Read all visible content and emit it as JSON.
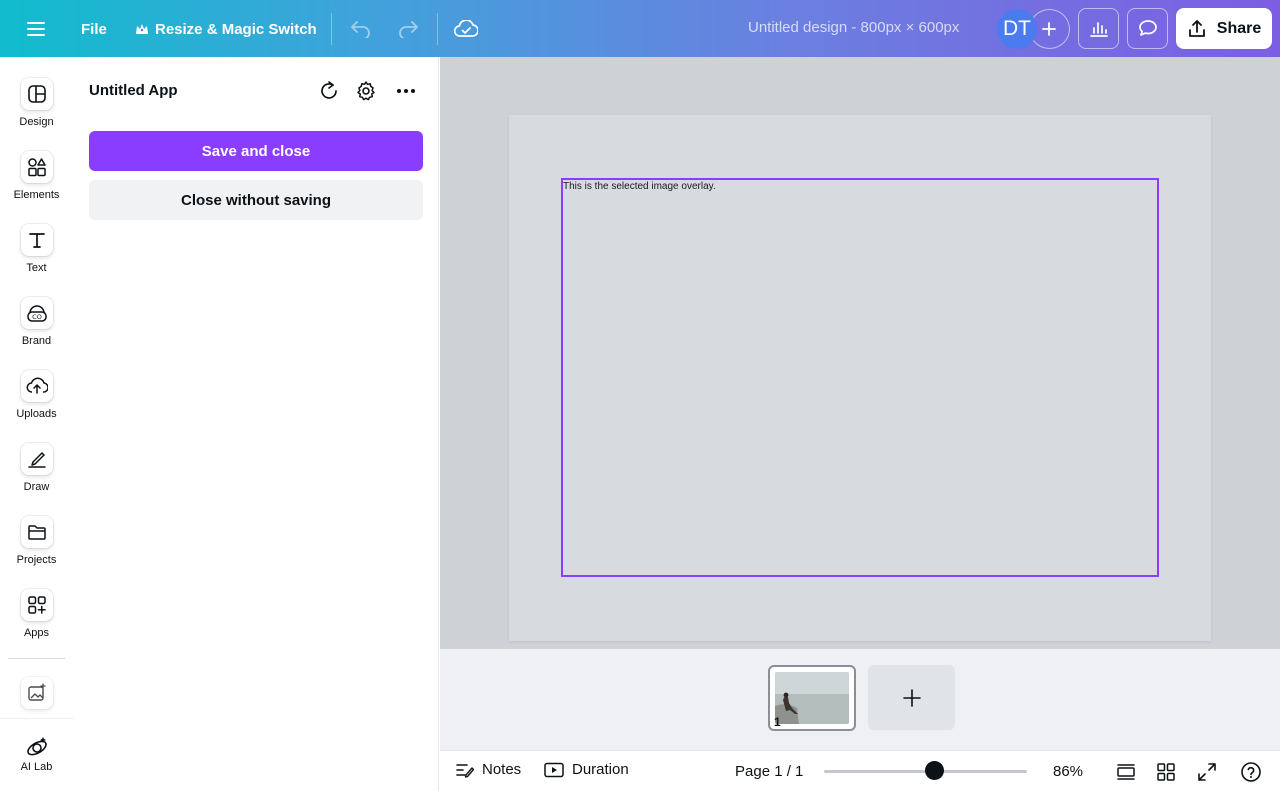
{
  "topbar": {
    "file_label": "File",
    "resize_label": "Resize & Magic Switch",
    "design_title": "Untitled design - 800px × 600px",
    "avatar_initials": "DT",
    "share_label": "Share"
  },
  "rail": {
    "items": [
      {
        "label": "Design",
        "icon": "layout-icon"
      },
      {
        "label": "Elements",
        "icon": "shapes-icon"
      },
      {
        "label": "Text",
        "icon": "text-icon"
      },
      {
        "label": "Brand",
        "icon": "brand-icon"
      },
      {
        "label": "Uploads",
        "icon": "cloud-upload-icon"
      },
      {
        "label": "Draw",
        "icon": "pen-icon"
      },
      {
        "label": "Projects",
        "icon": "folder-icon"
      },
      {
        "label": "Apps",
        "icon": "apps-grid-icon"
      }
    ],
    "magic_media_icon": "magic-image-icon",
    "ai_lab_label": "AI Lab"
  },
  "panel": {
    "title": "Untitled App",
    "save_close_label": "Save and close",
    "close_no_save_label": "Close without saving"
  },
  "canvas": {
    "overlay_text": "This is the selected image overlay."
  },
  "pages": {
    "thumbnail_number": "1"
  },
  "bottombar": {
    "notes_label": "Notes",
    "duration_label": "Duration",
    "page_indicator": "Page 1 / 1",
    "zoom_percent": 86,
    "zoom_label": "86%"
  },
  "colors": {
    "accent": "#8b3dff",
    "avatar": "#4a7cf0",
    "canvas_bg": "#ced2d7"
  }
}
